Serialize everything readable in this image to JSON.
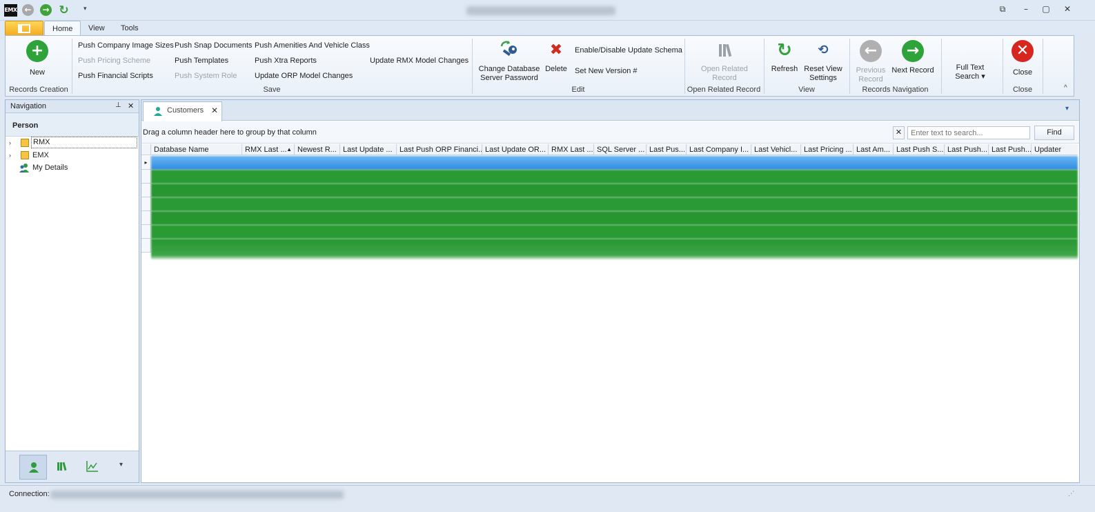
{
  "quick_access": {
    "app_logo": "EMX",
    "back_icon": "back-arrow-icon",
    "forward_icon": "forward-arrow-icon",
    "refresh_icon": "refresh-icon",
    "customize_label": "▾"
  },
  "window_controls": {
    "restore_icon": "restore-window-icon",
    "minimize_icon": "minimize-icon",
    "maximize_icon": "maximize-icon",
    "close_icon": "close-icon"
  },
  "ribbon_tabs": [
    "Home",
    "View",
    "Tools"
  ],
  "ribbon": {
    "records_creation": {
      "new_label": "New",
      "group_label": "Records Creation"
    },
    "save": {
      "push_company_image_sizes": "Push Company Image Sizes",
      "push_pricing_scheme": "Push Pricing Scheme",
      "push_financial_scripts": "Push Financial Scripts",
      "push_snap_documents": "Push Snap Documents",
      "push_templates": "Push Templates",
      "push_system_role": "Push System Role",
      "push_amenities": "Push Amenities And Vehicle Class",
      "push_xtra_reports": "Push Xtra Reports",
      "update_orp_model": "Update ORP Model Changes",
      "update_rmx_model": "Update RMX Model Changes",
      "group_label": "Save"
    },
    "edit": {
      "change_password_line1": "Change Database",
      "change_password_line2": "Server Password",
      "delete_label": "Delete",
      "enable_disable_schema": "Enable/Disable Update Schema",
      "set_new_version": "Set New Version #",
      "group_label": "Edit"
    },
    "open_related": {
      "line1": "Open Related",
      "line2": "Record",
      "group_label": "Open Related Record"
    },
    "view": {
      "refresh_label": "Refresh",
      "reset_line1": "Reset View",
      "reset_line2": "Settings",
      "group_label": "View"
    },
    "records_navigation": {
      "previous_line1": "Previous",
      "previous_line2": "Record",
      "next_label": "Next Record",
      "group_label": "Records Navigation"
    },
    "full_text": {
      "line1": "Full Text",
      "line2": "Search ▾"
    },
    "close": {
      "close_label": "Close",
      "group_label": "Close"
    },
    "collapse_icon": "^"
  },
  "navigation": {
    "title": "Navigation",
    "pin_icon": "📌",
    "close_icon": "✕",
    "section": "Person",
    "tree": [
      {
        "label": "RMX",
        "expand": "›"
      },
      {
        "label": "EMX",
        "expand": "›"
      },
      {
        "label": "My Details",
        "expand": ""
      }
    ],
    "bottom_icons": [
      "person-icon",
      "library-icon",
      "chart-icon"
    ],
    "bottom_more": "▾"
  },
  "document": {
    "tab_label": "Customers",
    "tab_close": "✕",
    "dropdown": "▾",
    "group_hint": "Drag a column header here to group by that column",
    "clear_label": "✕",
    "search_placeholder": "Enter text to search...",
    "find_label": "Find"
  },
  "grid": {
    "columns": [
      "Database Name",
      "RMX Last ...",
      "Newest R...",
      "Last Update ...",
      "Last Push ORP Financi...",
      "Last Update OR...",
      "RMX Last ...",
      "SQL Server ...",
      "Last Pus...",
      "Last Company I...",
      "Last Vehicl...",
      "Last Pricing ...",
      "Last Am...",
      "Last Push S...",
      "Last Push...",
      "Last Push...",
      "Updater"
    ],
    "sort_indicator": "▲",
    "row_count_visible": 7,
    "selected_row_color": "#3d9be9",
    "row_color": "#2e9e36"
  },
  "status": {
    "connection_label": "Connection:"
  }
}
